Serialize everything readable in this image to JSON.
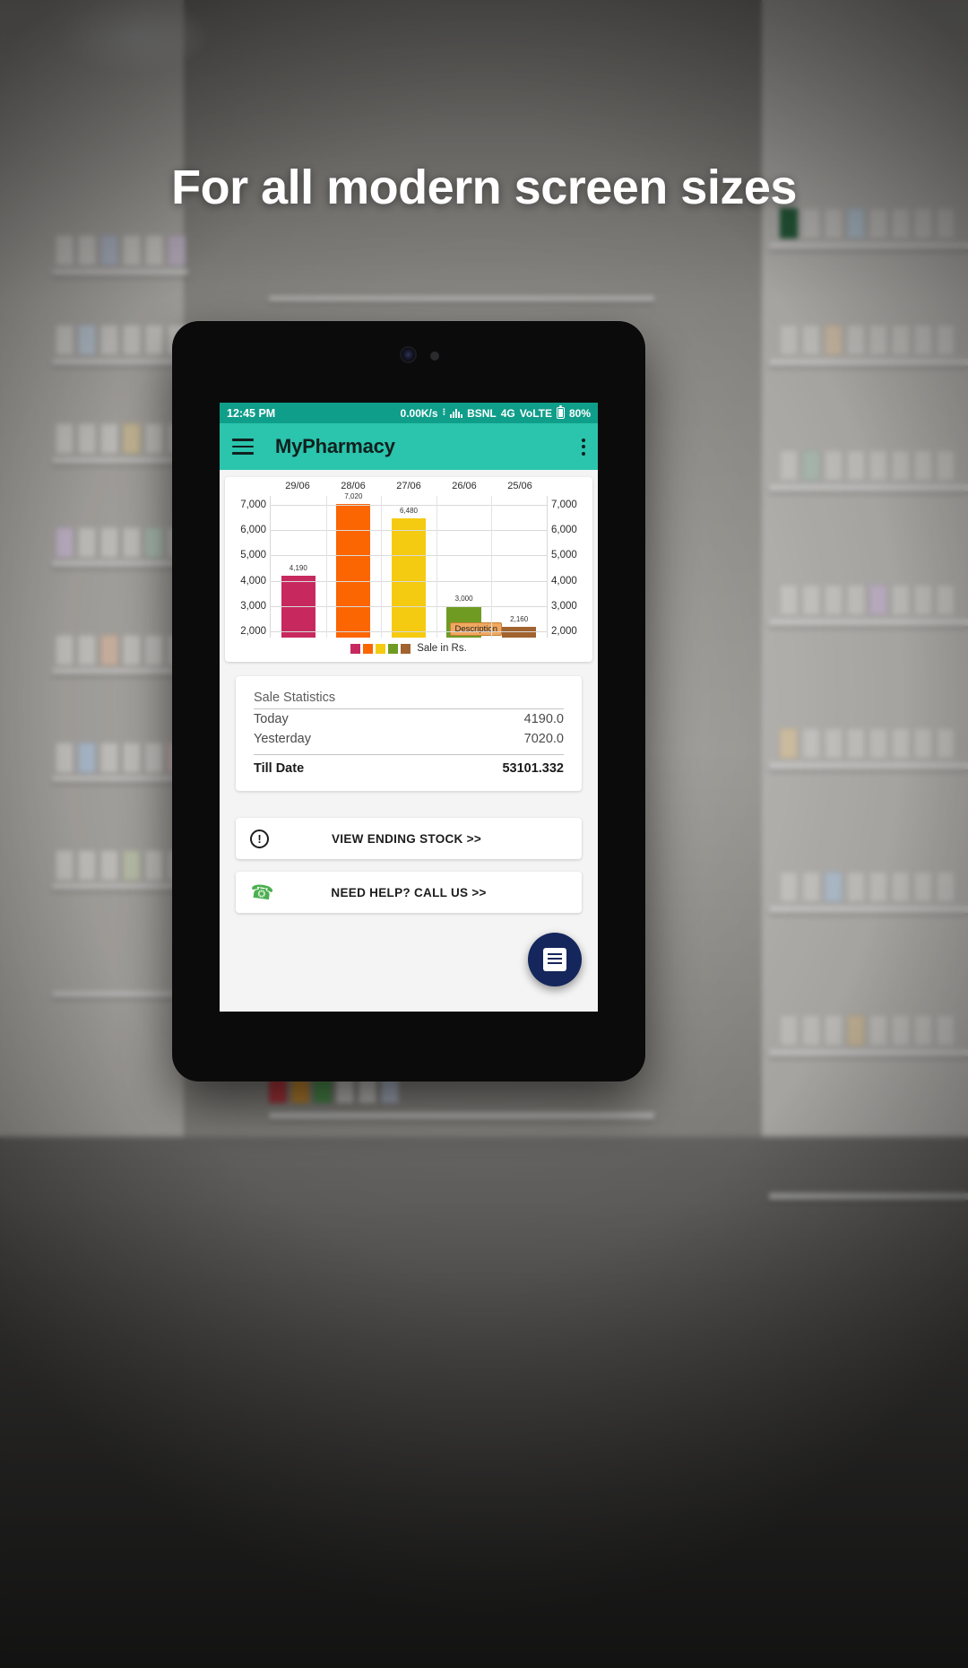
{
  "promo": {
    "headline": "For all modern screen sizes"
  },
  "device": {
    "camera_icon": "camera-lens-icon",
    "sensor_icon": "proximity-sensor-icon"
  },
  "statusbar": {
    "time": "12:45 PM",
    "network_speed": "0.00K/s",
    "carrier": "BSNL",
    "network_type": "4G",
    "volte": "VoLTE",
    "battery_percent": "80%",
    "signal_icon": "signal-bars-icon",
    "battery_icon": "battery-icon",
    "background_color": "#0f9e8a"
  },
  "appbar": {
    "menu_icon": "hamburger-menu-icon",
    "title": "MyPharmacy",
    "overflow_icon": "kebab-menu-icon",
    "background_color": "#2bc4ad"
  },
  "chart_data": {
    "type": "bar",
    "title": "",
    "categories": [
      "29/06",
      "28/06",
      "27/06",
      "26/06",
      "25/06"
    ],
    "values": [
      4190,
      7020,
      6480,
      3000,
      2160
    ],
    "value_labels": [
      "4,190",
      "7,020",
      "6,480",
      "3,000",
      "2,160"
    ],
    "colors": [
      "#c7295e",
      "#fb6502",
      "#f5cb11",
      "#6f9b23",
      "#a1632f"
    ],
    "legend": [
      "Sale in Rs."
    ],
    "legend_position": "bottom",
    "xlabel": "",
    "ylabel": "",
    "ylim": [
      1750,
      7350
    ],
    "yticks": [
      2000,
      3000,
      4000,
      5000,
      6000,
      7000
    ],
    "ytick_labels": [
      "2,000",
      "3,000",
      "4,000",
      "5,000",
      "6,000",
      "7,000"
    ],
    "dual_axis": true,
    "grid": true,
    "annotation": "Description"
  },
  "stats": {
    "title": "Sale Statistics",
    "rows": [
      {
        "label": "Today",
        "value": "4190.0"
      },
      {
        "label": "Yesterday",
        "value": "7020.0"
      }
    ],
    "total": {
      "label": "Till Date",
      "value": "53101.332"
    }
  },
  "actions": [
    {
      "icon": "alert-circle-icon",
      "label": "VIEW ENDING STOCK >>"
    },
    {
      "icon": "phone-call-icon",
      "label": "NEED HELP? CALL US  >>"
    }
  ],
  "fab": {
    "icon": "receipt-icon",
    "color": "#15265c"
  }
}
